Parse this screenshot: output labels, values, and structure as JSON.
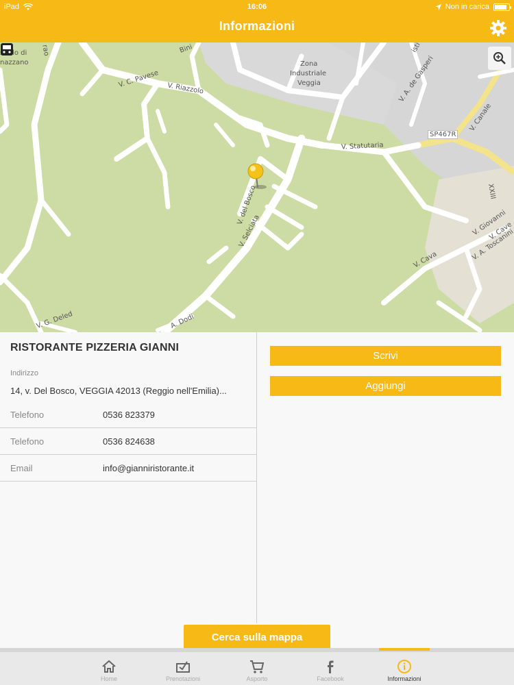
{
  "status_bar": {
    "device": "iPad",
    "time": "16:06",
    "charging": "Non in carica",
    "battery_level": 0.85
  },
  "header": {
    "title": "Informazioni",
    "settings_icon": "gear-icon"
  },
  "map": {
    "labels": {
      "castello": "stello di",
      "nazzano": "nazzano",
      "bini": "Bini",
      "zona": "Zona",
      "industriale": "Industriale",
      "veggia": "Veggia",
      "pavese": "V. C. Pavese",
      "riazzolo": "V. Riazzolo",
      "statutaria": "V. Statutaria",
      "sp467r": "SP467R",
      "canale": "V. Canale",
      "degasperi": "V. A. de Gasperi",
      "delbosco": "V. del Bosco",
      "selciata": "V. Selciata",
      "xxiii": "XXIII",
      "giovanni": "V. Giovanni",
      "cave": "V. Cave",
      "toscanini": "V. A. Toscanini",
      "cava": "V. Cava",
      "dodi": "A. Dodi",
      "deled": "V. G. Deled",
      "rao": "rao",
      "isti": "isti"
    },
    "icons": [
      "zoom-icon",
      "bus-stop-icon",
      "map-pin-icon"
    ]
  },
  "info": {
    "name": "RISTORANTE PIZZERIA GIANNI",
    "address_label": "Indirizzo",
    "address": "14, v. Del Bosco, VEGGIA 42013 (Reggio nell'Emilia)...",
    "rows": [
      {
        "label": "Telefono",
        "value": "0536 823379"
      },
      {
        "label": "Telefono",
        "value": "0536 824638"
      },
      {
        "label": "Email",
        "value": "info@gianniristorante.it"
      }
    ]
  },
  "actions": {
    "write": "Scrivi",
    "add": "Aggiungi",
    "search_map": "Cerca sulla mappa"
  },
  "tabs": [
    {
      "label": "Home",
      "icon": "home-icon"
    },
    {
      "label": "Prenotazioni",
      "icon": "reservation-icon"
    },
    {
      "label": "Asporto",
      "icon": "cart-icon"
    },
    {
      "label": "Facebook",
      "icon": "facebook-icon"
    },
    {
      "label": "Informazioni",
      "icon": "info-icon",
      "active": true
    }
  ],
  "colors": {
    "accent": "#f7b916",
    "map_green": "#cddba4",
    "map_gray": "#d9d9d9"
  }
}
